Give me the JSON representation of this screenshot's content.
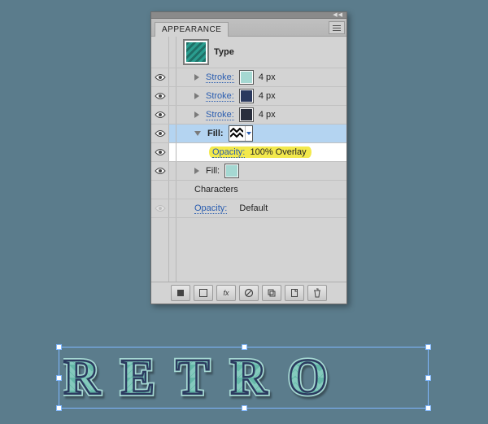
{
  "panel": {
    "title": "APPEARANCE",
    "object_kind": "Type",
    "characters_label": "Characters",
    "strokes": [
      {
        "label": "Stroke:",
        "color": "#a5d8d2",
        "weight": "4 px"
      },
      {
        "label": "Stroke:",
        "color": "#2b3a5f",
        "weight": "4 px"
      },
      {
        "label": "Stroke:",
        "color": "#2a2f3d",
        "weight": "4 px"
      }
    ],
    "fills": [
      {
        "label": "Fill:",
        "pattern": "chevron",
        "selected": true,
        "opacity": {
          "label": "Opacity:",
          "value": "100% Overlay",
          "highlighted": true
        }
      },
      {
        "label": "Fill:",
        "color": "#a5d8d2"
      }
    ],
    "opacity_bottom": {
      "label": "Opacity:",
      "value": "Default"
    },
    "thumb_color": "#2a9d8f"
  },
  "artwork": {
    "text": "RETRO",
    "fill_color": "#64b8a8",
    "stroke_outer": "#a5d8d2",
    "stroke_mid": "#2b3a5f",
    "stroke_inner": "#2a2f3d"
  }
}
